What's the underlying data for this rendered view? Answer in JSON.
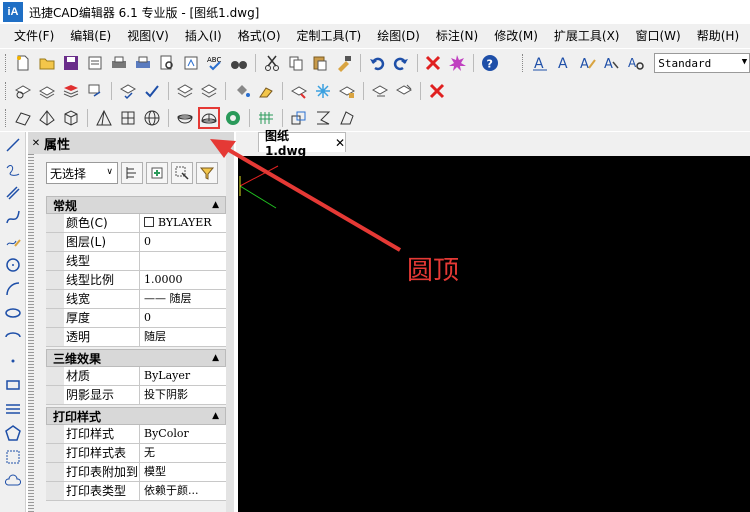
{
  "window": {
    "title": "迅捷CAD编辑器 6.1 专业版  - [图纸1.dwg]",
    "logo_text": "iA"
  },
  "menu": [
    "文件(F)",
    "编辑(E)",
    "视图(V)",
    "插入(I)",
    "格式(O)",
    "定制工具(T)",
    "绘图(D)",
    "标注(N)",
    "修改(M)",
    "扩展工具(X)",
    "窗口(W)",
    "帮助(H)"
  ],
  "toolbar": {
    "text_style_value": "Standard"
  },
  "panel": {
    "title": "属性",
    "selection_value": "无选择",
    "sections": [
      {
        "name": "常规",
        "rows": [
          {
            "k": "颜色(C)",
            "v": "BYLAYER"
          },
          {
            "k": "图层(L)",
            "v": "0"
          },
          {
            "k": "线型",
            "v": ""
          },
          {
            "k": "线型比例",
            "v": "1.0000"
          },
          {
            "k": "线宽",
            "v": "—— 随层"
          },
          {
            "k": "厚度",
            "v": "0"
          },
          {
            "k": "透明",
            "v": "随层"
          }
        ]
      },
      {
        "name": "三维效果",
        "rows": [
          {
            "k": "材质",
            "v": "ByLayer"
          },
          {
            "k": "阴影显示",
            "v": "投下阴影"
          }
        ]
      },
      {
        "name": "打印样式",
        "rows": [
          {
            "k": "打印样式",
            "v": "ByColor"
          },
          {
            "k": "打印样式表",
            "v": "无"
          },
          {
            "k": "打印表附加到",
            "v": "模型"
          },
          {
            "k": "打印表类型",
            "v": "依赖于颜..."
          }
        ]
      }
    ]
  },
  "document": {
    "tab_label": "图纸1.dwg",
    "tab_close": "✕"
  },
  "annotation": {
    "label": "圆顶",
    "color": "#e53935"
  }
}
